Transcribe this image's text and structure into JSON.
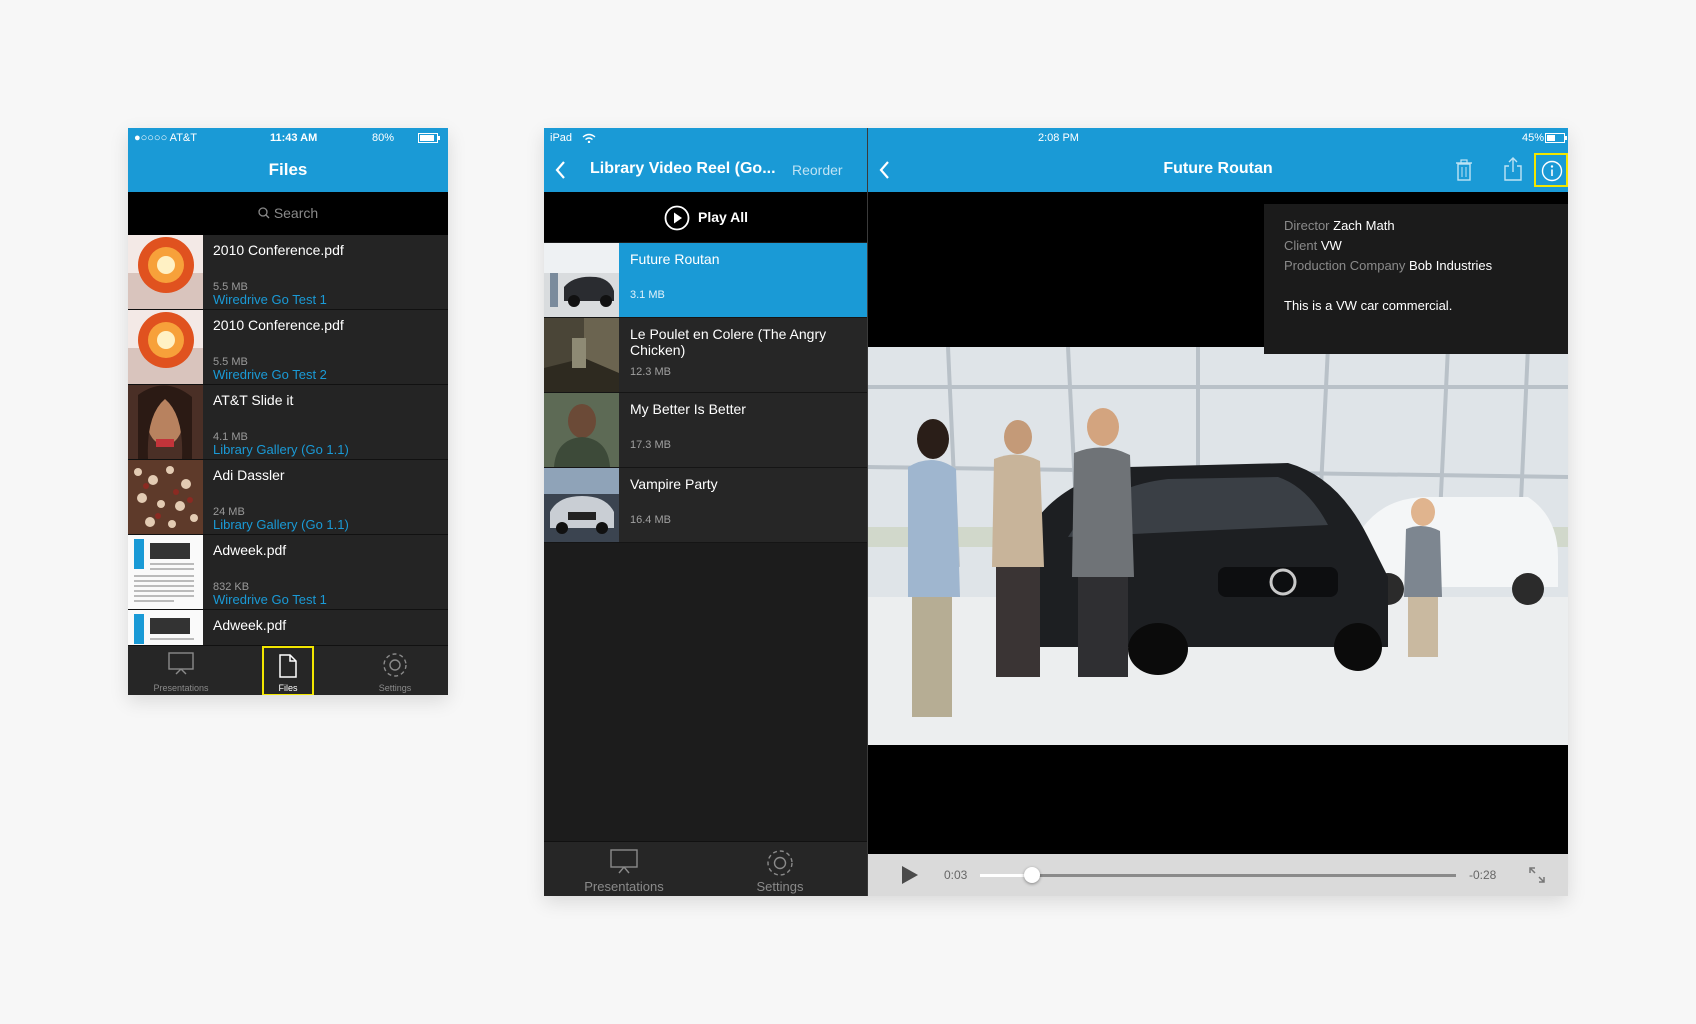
{
  "phone": {
    "status": {
      "carrier": "●○○○○ AT&T",
      "time": "11:43 AM",
      "battery": "80%"
    },
    "nav_title": "Files",
    "search_placeholder": "Search",
    "files": [
      {
        "name": "2010 Conference.pdf",
        "size": "5.5 MB",
        "source": "Wiredrive Go Test 1"
      },
      {
        "name": "2010 Conference.pdf",
        "size": "5.5 MB",
        "source": "Wiredrive Go Test 2"
      },
      {
        "name": "AT&T Slide it",
        "size": "4.1 MB",
        "source": "Library Gallery (Go 1.1)"
      },
      {
        "name": "Adi Dassler",
        "size": "24 MB",
        "source": "Library Gallery (Go 1.1)"
      },
      {
        "name": "Adweek.pdf",
        "size": "832 KB",
        "source": "Wiredrive Go Test 1"
      },
      {
        "name": "Adweek.pdf",
        "size": "",
        "source": ""
      }
    ],
    "tabs": [
      {
        "label": "Presentations",
        "icon": "presentation-icon"
      },
      {
        "label": "Files",
        "icon": "file-icon",
        "selected": true
      },
      {
        "label": "Settings",
        "icon": "gear-icon"
      }
    ]
  },
  "tablet": {
    "status": {
      "device": "iPad",
      "time": "2:08 PM",
      "battery": "45%"
    },
    "master": {
      "title": "Library Video Reel (Go...",
      "reorder": "Reorder",
      "play_all": "Play All",
      "items": [
        {
          "name": "Future Routan",
          "size": "3.1 MB",
          "selected": true
        },
        {
          "name": "Le Poulet en Colere (The Angry Chicken)",
          "size": "12.3 MB"
        },
        {
          "name": "My Better Is Better",
          "size": "17.3 MB"
        },
        {
          "name": "Vampire Party",
          "size": "16.4 MB"
        }
      ],
      "tabs": [
        {
          "label": "Presentations",
          "icon": "presentation-icon"
        },
        {
          "label": "Settings",
          "icon": "gear-icon"
        }
      ]
    },
    "detail": {
      "title": "Future Routan",
      "info": {
        "director_key": "Director",
        "director": "Zach Math",
        "client_key": "Client",
        "client": "VW",
        "production_key": "Production Company",
        "production": "Bob Industries",
        "description": "This is a VW car commercial."
      },
      "player": {
        "elapsed": "0:03",
        "remaining": "-0:28",
        "progress": 0.11
      }
    }
  },
  "colors": {
    "accent": "#1a9ad6",
    "highlight": "#f2e600"
  }
}
